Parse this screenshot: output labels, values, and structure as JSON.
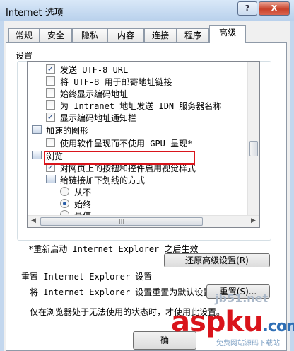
{
  "window": {
    "title": "Internet 选项",
    "help_label": "?",
    "close_label": "X"
  },
  "tabs": [
    "常规",
    "安全",
    "隐私",
    "内容",
    "连接",
    "程序",
    "高级"
  ],
  "settings_label": "设置",
  "settings_rows": [
    {
      "text": "发送 UTF-8 URL",
      "control": "checkbox",
      "checked": true
    },
    {
      "text": "将 UTF-8 用于邮寄地址链接",
      "control": "checkbox",
      "checked": false
    },
    {
      "text": "始终显示编码地址",
      "control": "checkbox",
      "checked": false
    },
    {
      "text": "为 Intranet 地址发送 IDN 服务器名称",
      "control": "checkbox",
      "checked": false
    },
    {
      "text": "显示编码地址通知栏",
      "control": "checkbox",
      "checked": true
    },
    {
      "text": "加速的图形",
      "control": "category",
      "checked": false
    },
    {
      "text": "使用软件呈现而不使用 GPU 呈现*",
      "control": "checkbox",
      "checked": false
    },
    {
      "text": "浏览",
      "control": "category",
      "checked": false
    },
    {
      "text": "对网页上的按钮和控件启用视觉样式",
      "control": "checkbox",
      "checked": true
    },
    {
      "text": "给链接加下划线的方式",
      "control": "category",
      "checked": false
    },
    {
      "text": "从不",
      "control": "radio",
      "checked": false
    },
    {
      "text": "始终",
      "control": "radio",
      "checked": true
    },
    {
      "text": "悬停",
      "control": "radio",
      "checked": false
    }
  ],
  "restart_note": "*重新启动 Internet Explorer 之后生效",
  "restore_button": "还原高级设置(R)",
  "reset": {
    "header": "重置 Internet Explorer 设置",
    "description": "将 Internet Explorer 设置重置为默认设置。",
    "button": "重置(S)...",
    "warning": "仅在浏览器处于无法使用的状态时，才使用此设置。"
  },
  "ok_button": "确",
  "watermark": {
    "small": "jb51.net",
    "big": "aspku",
    "big_suffix": ".com",
    "sub": "免费网站源码下载站"
  },
  "colors": {
    "titlebar": "#c3d7ee",
    "highlight_border": "#d9141b",
    "watermark_red": "#d9141b",
    "watermark_blue": "#2f6fb5"
  }
}
